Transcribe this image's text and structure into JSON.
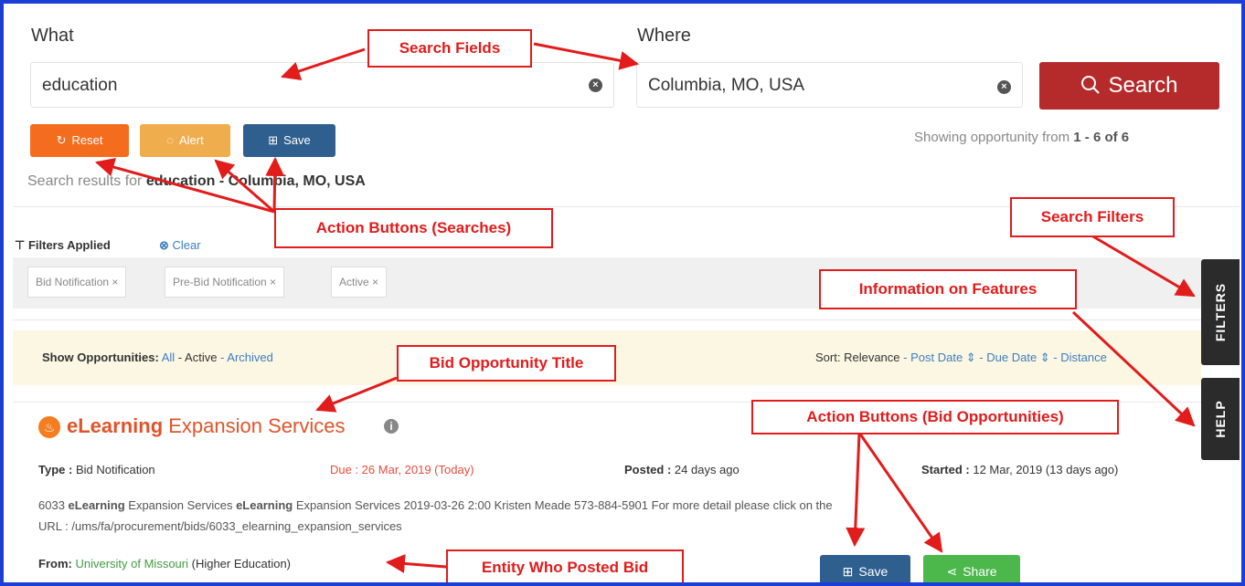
{
  "search": {
    "what_label": "What",
    "where_label": "Where",
    "what_value": "education",
    "where_value": "Columbia, MO, USA",
    "search_button": "Search",
    "showing_prefix": "Showing opportunity from ",
    "showing_range": "1 - 6 of 6"
  },
  "actions": {
    "reset": "Reset",
    "alert": "Alert",
    "save": "Save"
  },
  "results": {
    "prefix": "Search results for ",
    "term": "education",
    "location": " - Columbia, MO, USA"
  },
  "filters": {
    "applied_label": "Filters Applied",
    "clear_label": "Clear",
    "chips": [
      "Bid Notification ×",
      "Pre-Bid Notification ×",
      "Active ×"
    ]
  },
  "show": {
    "label": "Show Opportunities:",
    "all": "All",
    "sep1": " - ",
    "active": "Active",
    "sep2": " - ",
    "archived": "Archived"
  },
  "sort": {
    "label": "Sort:",
    "relevance": "Relevance",
    "sep": " - ",
    "post_date": "Post Date ⇕",
    "due_date": "Due Date ⇕",
    "distance": "Distance"
  },
  "side_tabs": {
    "filters": "FILTERS",
    "help": "HELP"
  },
  "bid": {
    "title_bold": "eLearning",
    "title_rest": " Expansion Services",
    "type_label": "Type :",
    "type_value": " Bid Notification",
    "due": "Due : 26 Mar, 2019 (Today)",
    "posted_label": "Posted :",
    "posted_value": " 24 days ago",
    "started_label": "Started :",
    "started_value": " 12 Mar, 2019 (13 days ago)",
    "desc_a": "6033 ",
    "desc_b": "eLearning",
    "desc_c": " Expansion Services ",
    "desc_d": "eLearning",
    "desc_e": " Expansion Services 2019-03-26 2:00 Kristen Meade 573-884-5901 For more detail please click on the",
    "desc_line2": "URL : /ums/fa/procurement/bids/6033_elearning_expansion_services",
    "from_label": "From:",
    "from_entity": "University of Missouri",
    "from_type": " (Higher Education)",
    "save": "Save",
    "share": "Share"
  },
  "annotations": {
    "search_fields": "Search Fields",
    "action_searches": "Action Buttons (Searches)",
    "search_filters": "Search Filters",
    "info_features": "Information on Features",
    "bid_title": "Bid Opportunity Title",
    "action_bids": "Action Buttons (Bid Opportunities)",
    "entity": "Entity Who Posted Bid"
  },
  "colors": {
    "frame": "#1b3fd6",
    "annotation": "#e21b1b",
    "search_button": "#b52a2a",
    "reset": "#f46d1e",
    "alert": "#f0ad4e",
    "save": "#2f5f8f",
    "share": "#4cb84c"
  }
}
